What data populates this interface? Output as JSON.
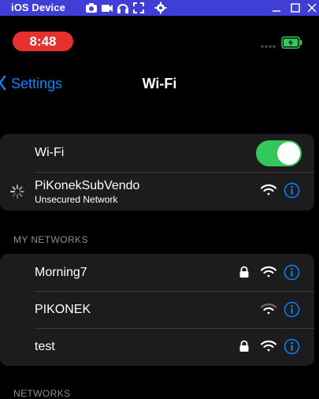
{
  "host": {
    "title": "iOS Device",
    "toolbar_icons": [
      "camera-icon",
      "video-icon",
      "headphones-icon",
      "fullscreen-icon",
      "settings-gear-icon"
    ],
    "window_controls": [
      "minimize-icon",
      "maximize-icon",
      "close-icon"
    ]
  },
  "status_bar": {
    "time": "8:48",
    "time_pill_color": "#e5302e",
    "battery_state": "charging",
    "battery_color": "#34c759"
  },
  "nav": {
    "back_label": "Settings",
    "title": "Wi-Fi"
  },
  "wifi_toggle": {
    "label": "Wi-Fi",
    "on": true,
    "color": "#34c759"
  },
  "current_network": {
    "name": "PiKonekSubVendo",
    "subtitle": "Unsecured Network",
    "connecting": true,
    "signal": "full",
    "icons": [
      "loading-spinner-icon",
      "wifi-signal-icon",
      "info-icon"
    ]
  },
  "my_networks": {
    "header": "MY NETWORKS",
    "items": [
      {
        "name": "Morning7",
        "secured": true,
        "signal": "full"
      },
      {
        "name": "PIKONEK",
        "secured": false,
        "signal": "medium"
      },
      {
        "name": "test",
        "secured": true,
        "signal": "full"
      }
    ]
  },
  "networks": {
    "header": "NETWORKS"
  },
  "colors": {
    "accent": "#0a84ff",
    "background": "#000000",
    "group_background": "#1c1c1e",
    "separator": "#3a3a3c",
    "host_bar": "#3f3fd8"
  }
}
